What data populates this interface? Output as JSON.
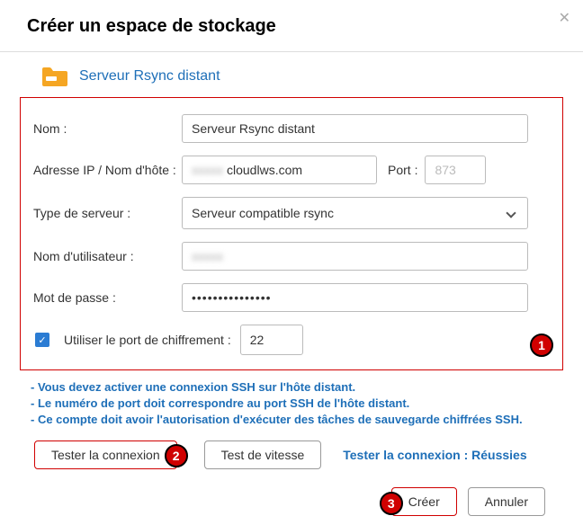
{
  "header": {
    "title": "Créer un espace de stockage"
  },
  "section": {
    "title": "Serveur Rsync distant"
  },
  "form": {
    "name_label": "Nom :",
    "name_value": "Serveur Rsync distant",
    "ip_label": "Adresse IP / Nom d'hôte :",
    "ip_prefix": "xxxxx",
    "ip_value": "cloudlws.com",
    "port_label": "Port :",
    "port_value": "873",
    "server_type_label": "Type de serveur :",
    "server_type_value": "Serveur compatible rsync",
    "user_label": "Nom d'utilisateur :",
    "user_value": "xxxxx",
    "pass_label": "Mot de passe :",
    "pass_value": "•••••••••••••••",
    "enc_label": "Utiliser le port de chiffrement :",
    "enc_port": "22"
  },
  "badges": {
    "b1": "1",
    "b2": "2",
    "b3": "3"
  },
  "notes": {
    "n1": "- Vous devez activer une connexion SSH sur l'hôte distant.",
    "n2": "- Le numéro de port doit correspondre au port SSH de l'hôte distant.",
    "n3": "- Ce compte doit avoir l'autorisation d'exécuter des tâches de sauvegarde chiffrées SSH."
  },
  "buttons": {
    "test_conn": "Tester la connexion",
    "test_speed": "Test de vitesse",
    "conn_result": "Tester la connexion : Réussies",
    "create": "Créer",
    "cancel": "Annuler"
  }
}
